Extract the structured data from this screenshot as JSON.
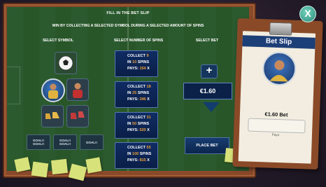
{
  "header": {
    "title": "FILL IN THE BET SLIP",
    "subtitle": "WIN BY COLLECTING A SELECTED SYMBOL DURING A SELECTED AMOUNT OF SPINS"
  },
  "columns": {
    "symbol": "SELECT SYMBOL",
    "spins": "SELECT NUMBER OF SPINS",
    "bet": "SELECT BET"
  },
  "symbols": [
    {
      "name": "ball-icon"
    },
    {
      "name": "goalkeeper-icon"
    },
    {
      "name": "player-icon"
    },
    {
      "name": "boots-icon"
    },
    {
      "name": "cleats-icon"
    },
    {
      "name": "goal-text-icon",
      "text": "GOAL!! GOAL!!"
    },
    {
      "name": "goal-text-icon",
      "text": "GOAL!! GOAL!!"
    },
    {
      "name": "goal-text-icon",
      "text": "GOAL!!"
    }
  ],
  "spin_options": [
    {
      "collect_label": "COLLECT",
      "collect": "9",
      "in_label": "IN",
      "spins": "10",
      "spins_label": "SPINS",
      "pays_label": "PAYS:",
      "pays": "154",
      "x": "X"
    },
    {
      "collect_label": "COLLECT",
      "collect": "18",
      "in_label": "IN",
      "spins": "25",
      "spins_label": "SPINS",
      "pays_label": "PAYS:",
      "pays": "346",
      "x": "X"
    },
    {
      "collect_label": "COLLECT",
      "collect": "31",
      "in_label": "IN",
      "spins": "50",
      "spins_label": "SPINS",
      "pays_label": "PAYS:",
      "pays": "520",
      "x": "X"
    },
    {
      "collect_label": "COLLECT",
      "collect": "55",
      "in_label": "IN",
      "spins": "100",
      "spins_label": "SPINS",
      "pays_label": "PAYS:",
      "pays": "815",
      "x": "X"
    }
  ],
  "bet": {
    "value": "€1.60",
    "increase": "+",
    "place_label": "PLACE BET"
  },
  "slip": {
    "title": "Bet Slip",
    "bet": "€1.60 Bet",
    "pays_label": "Pays"
  },
  "close_label": "X",
  "colors": {
    "accent": "#f0a036",
    "board": "#2b5a2f",
    "slip_header": "#1d3f78"
  }
}
